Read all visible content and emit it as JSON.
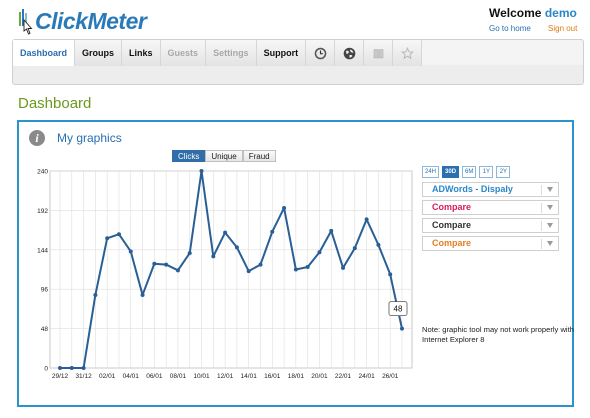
{
  "header": {
    "logo_text": "ClickMeter",
    "welcome_text": "Welcome",
    "username": "demo",
    "go_to_home": "Go to home",
    "sign_out": "Sign out"
  },
  "nav": {
    "tabs": [
      {
        "label": "Dashboard",
        "state": "active"
      },
      {
        "label": "Groups",
        "state": "normal"
      },
      {
        "label": "Links",
        "state": "normal"
      },
      {
        "label": "Guests",
        "state": "disabled"
      },
      {
        "label": "Settings",
        "state": "disabled"
      },
      {
        "label": "Support",
        "state": "normal"
      }
    ],
    "icon_tabs": [
      "clock-icon",
      "globe-icon",
      "book-icon",
      "star-icon"
    ]
  },
  "page": {
    "title": "Dashboard"
  },
  "panel": {
    "title": "My graphics",
    "metric_tabs": [
      {
        "label": "Clicks",
        "active": true
      },
      {
        "label": "Unique",
        "active": false
      },
      {
        "label": "Fraud",
        "active": false
      }
    ],
    "ranges": [
      {
        "label": "24H",
        "active": false
      },
      {
        "label": "30D",
        "active": true
      },
      {
        "label": "6M",
        "active": false
      },
      {
        "label": "1Y",
        "active": false
      },
      {
        "label": "2Y",
        "active": false
      }
    ],
    "selects": [
      {
        "label": "ADWords - Dispaly",
        "color": "#2a86c8"
      },
      {
        "label": "Compare",
        "color": "#d81b60"
      },
      {
        "label": "Compare",
        "color": "#333333"
      },
      {
        "label": "Compare",
        "color": "#e67e22"
      }
    ],
    "note": "Note: graphic tool may not work properly with Internet Explorer 8"
  },
  "chart_data": {
    "type": "line",
    "x": [
      "29/12",
      "30/12",
      "31/12",
      "01/01",
      "02/01",
      "03/01",
      "04/01",
      "05/01",
      "06/01",
      "07/01",
      "08/01",
      "09/01",
      "10/01",
      "11/01",
      "12/01",
      "13/01",
      "14/01",
      "15/01",
      "16/01",
      "17/01",
      "18/01",
      "19/01",
      "20/01",
      "21/01",
      "22/01",
      "23/01",
      "24/01",
      "25/01",
      "26/01",
      "27/01"
    ],
    "x_tick_labels": [
      "29/12",
      "31/12",
      "02/01",
      "04/01",
      "06/01",
      "08/01",
      "10/01",
      "12/01",
      "14/01",
      "16/01",
      "18/01",
      "20/01",
      "22/01",
      "24/01",
      "26/01"
    ],
    "series": [
      {
        "values": [
          0,
          0,
          0,
          89,
          158,
          163,
          142,
          89,
          127,
          126,
          119,
          140,
          240,
          136,
          165,
          147,
          118,
          126,
          166,
          195,
          120,
          123,
          141,
          167,
          122,
          146,
          181,
          150,
          114,
          48
        ],
        "color": "#2a5f96"
      }
    ],
    "y_ticks": [
      0,
      48,
      96,
      144,
      192,
      240
    ],
    "ylim": [
      0,
      240
    ],
    "tooltip": "48",
    "grid": true
  },
  "colors": {
    "accent": "#2b94cc",
    "title_green": "#6a9a1e",
    "link_blue": "#2a6fb0",
    "sign_out": "#e07a12"
  }
}
